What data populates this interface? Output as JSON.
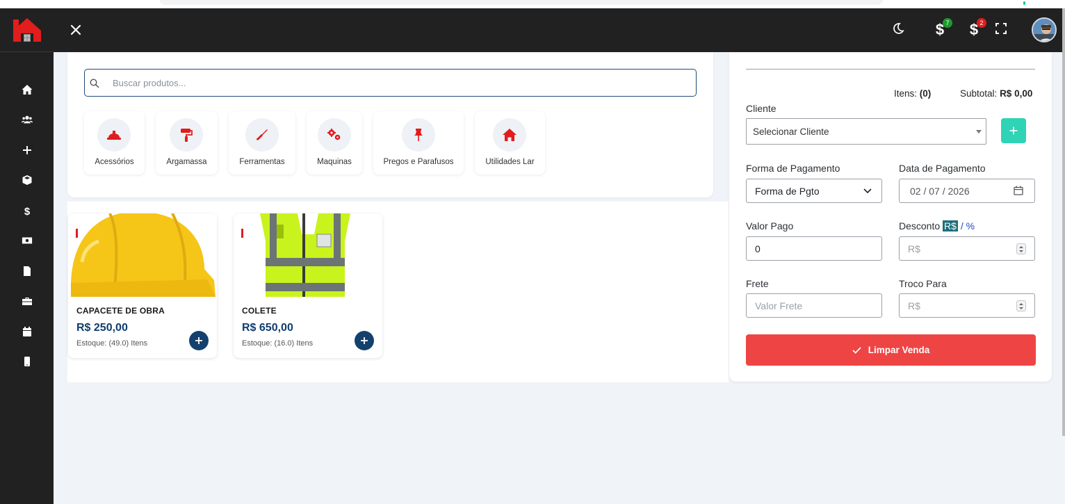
{
  "colors": {
    "sidebar_bg": "#212121",
    "brand_red": "#e11d1d",
    "price_blue": "#0f3d6e",
    "add_client_teal": "#2fd3b5",
    "clear_button_red": "#ef4444",
    "badge_green": "#1d9a2b",
    "badge_red": "#e11d1d"
  },
  "sidebar": {
    "icons": [
      "home-icon",
      "users-icon",
      "plus-icon",
      "box-icon",
      "dollar-icon",
      "money-icon",
      "file-icon",
      "briefcase-icon",
      "calendar-icon",
      "mobile-icon"
    ]
  },
  "topbar": {
    "badges": {
      "sales": "7",
      "payables": "2"
    }
  },
  "search": {
    "placeholder": "Buscar produtos..."
  },
  "categories": [
    {
      "label": "Acessórios",
      "icon": "hard-hat-icon"
    },
    {
      "label": "Argamassa",
      "icon": "paint-roller-icon"
    },
    {
      "label": "Ferramentas",
      "icon": "screwdriver-icon"
    },
    {
      "label": "Maquinas",
      "icon": "gears-icon"
    },
    {
      "label": "Pregos e Parafusos",
      "icon": "thumbtack-icon"
    },
    {
      "label": "Utilidades Lar",
      "icon": "house-icon"
    }
  ],
  "products": [
    {
      "name": "CAPACETE DE OBRA",
      "price": "R$ 250,00",
      "stock": "Estoque: (49.0) Itens"
    },
    {
      "name": "COLETE",
      "price": "R$ 650,00",
      "stock": "Estoque: (16.0) Itens"
    }
  ],
  "cart": {
    "items_label": "Itens:",
    "items_value": "(0)",
    "subtotal_label": "Subtotal:",
    "subtotal_value": "R$ 0,00",
    "cliente_label": "Cliente",
    "cliente_value": "Selecionar Cliente",
    "forma_label": "Forma de Pagamento",
    "forma_value": "Forma de Pgto",
    "data_label": "Data de Pagamento",
    "data_value": "02 / 07 / 2026",
    "valor_pago_label": "Valor Pago",
    "valor_pago_value": "0",
    "desconto_label": "Desconto",
    "desconto_rs": "R$",
    "desconto_sep": " / ",
    "desconto_pct": "%",
    "desconto_placeholder": "R$",
    "frete_label": "Frete",
    "frete_placeholder": "Valor Frete",
    "troco_label": "Troco Para",
    "troco_placeholder": "R$",
    "clear_button": "Limpar Venda"
  }
}
